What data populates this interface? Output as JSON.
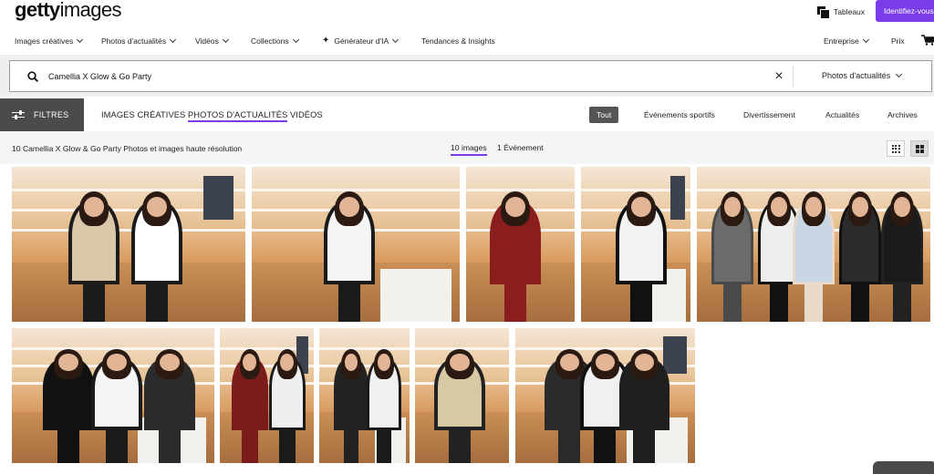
{
  "header": {
    "logo_bold": "getty",
    "logo_regular": "images",
    "boards_label": "Tableaux",
    "signin_label": "Identifiez-vous"
  },
  "nav": {
    "items": [
      {
        "label": "Images créatives",
        "has_menu": true
      },
      {
        "label": "Photos d'actualités",
        "has_menu": true
      },
      {
        "label": "Vidéos",
        "has_menu": true
      },
      {
        "label": "Collections",
        "has_menu": true
      },
      {
        "label": "Générateur d'IA",
        "has_menu": true
      },
      {
        "label": "Tendances & Insights",
        "has_menu": false
      }
    ],
    "enterprise_label": "Entreprise",
    "pricing_label": "Prix"
  },
  "search": {
    "query": "Camellia X Glow & Go Party",
    "type_selected": "Photos d'actualités"
  },
  "filters": {
    "button_label": "FILTRES",
    "media_tabs": [
      "IMAGES CRÉATIVES",
      "PHOTOS D'ACTUALITÉS",
      "VIDÉOS"
    ],
    "media_active_index": 1,
    "categories": [
      "Tout",
      "Événements sportifs",
      "Divertissement",
      "Actualités",
      "Archives"
    ],
    "category_active_index": 0
  },
  "results": {
    "summary": "10 Camellia X Glow & Go Party Photos et images haute résolution",
    "scope_tabs": [
      "10 images",
      "1 Événement"
    ],
    "scope_active_index": 0,
    "view_modes": [
      "grid-small",
      "grid-large"
    ],
    "view_active": "grid-large"
  },
  "colors": {
    "accent": "#7a3cea",
    "filter_button": "#4b4b4b",
    "category_active": "#555555"
  }
}
